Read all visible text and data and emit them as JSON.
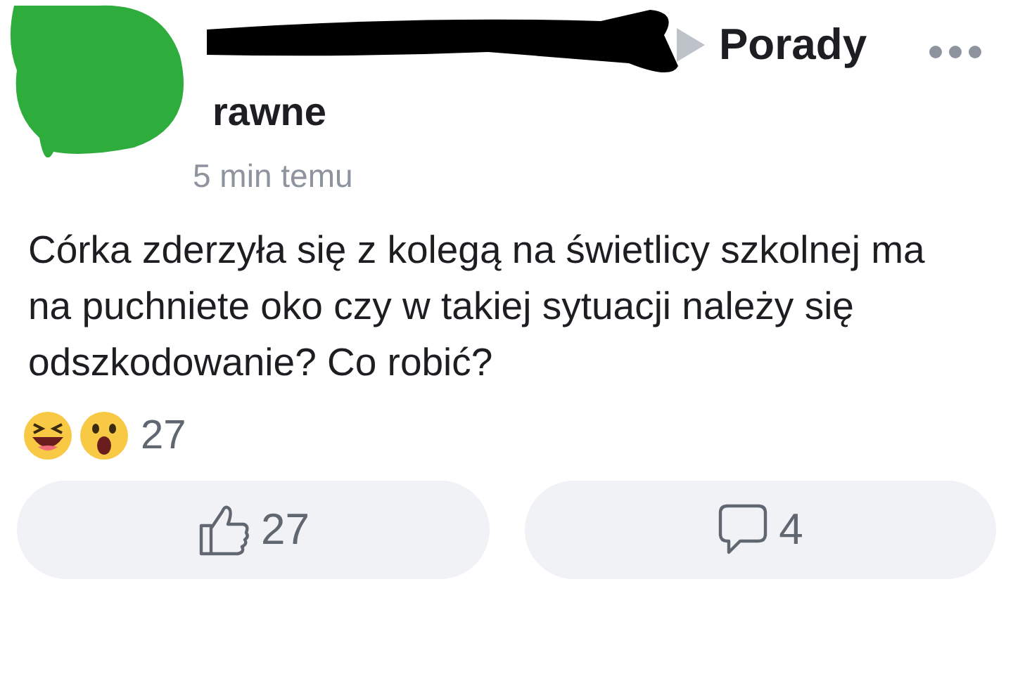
{
  "post": {
    "group_name": "Porady",
    "group_name_cont": "rawne",
    "time": "5 min temu",
    "text": "Córka zderzyła się z kolegą na świetlicy szkolnej ma na puchniete oko czy w takiej sytuacji należy się odszkodowanie? Co robić?",
    "reactions": {
      "count": "27"
    },
    "actions": [
      {
        "kind": "like",
        "label": "27"
      },
      {
        "kind": "comment",
        "label": "4"
      }
    ]
  }
}
